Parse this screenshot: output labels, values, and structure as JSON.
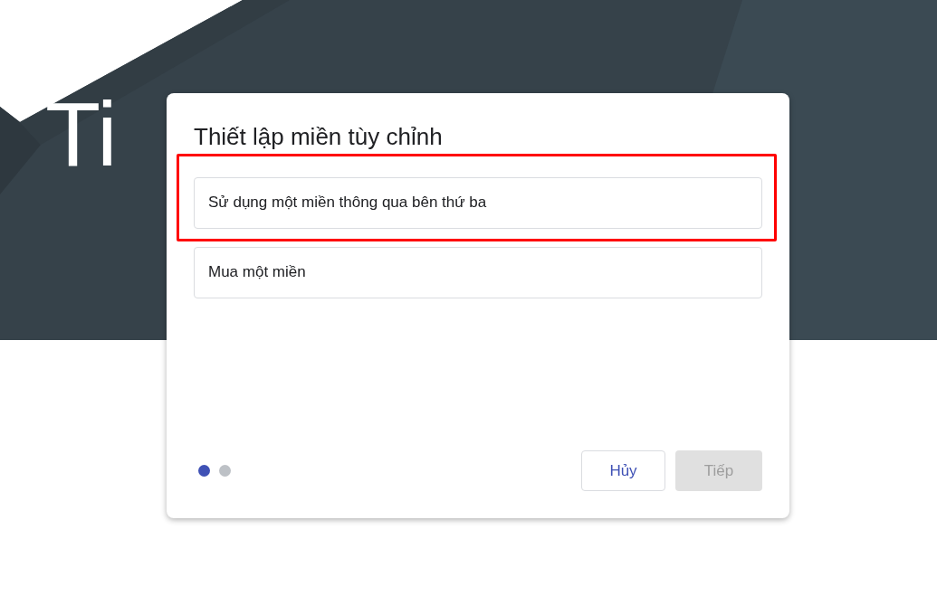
{
  "hero": {
    "title": "Ti"
  },
  "dialog": {
    "title": "Thiết lập miền tùy chỉnh",
    "options": [
      {
        "label": "Sử dụng một miền thông qua bên thứ ba",
        "highlighted": true
      },
      {
        "label": "Mua một miền",
        "highlighted": false
      }
    ],
    "steps": [
      {
        "selected": true
      },
      {
        "selected": false
      }
    ],
    "buttons": [
      {
        "label": "Hủy",
        "disabled": false
      },
      {
        "label": "Tiếp",
        "disabled": true
      }
    ]
  }
}
